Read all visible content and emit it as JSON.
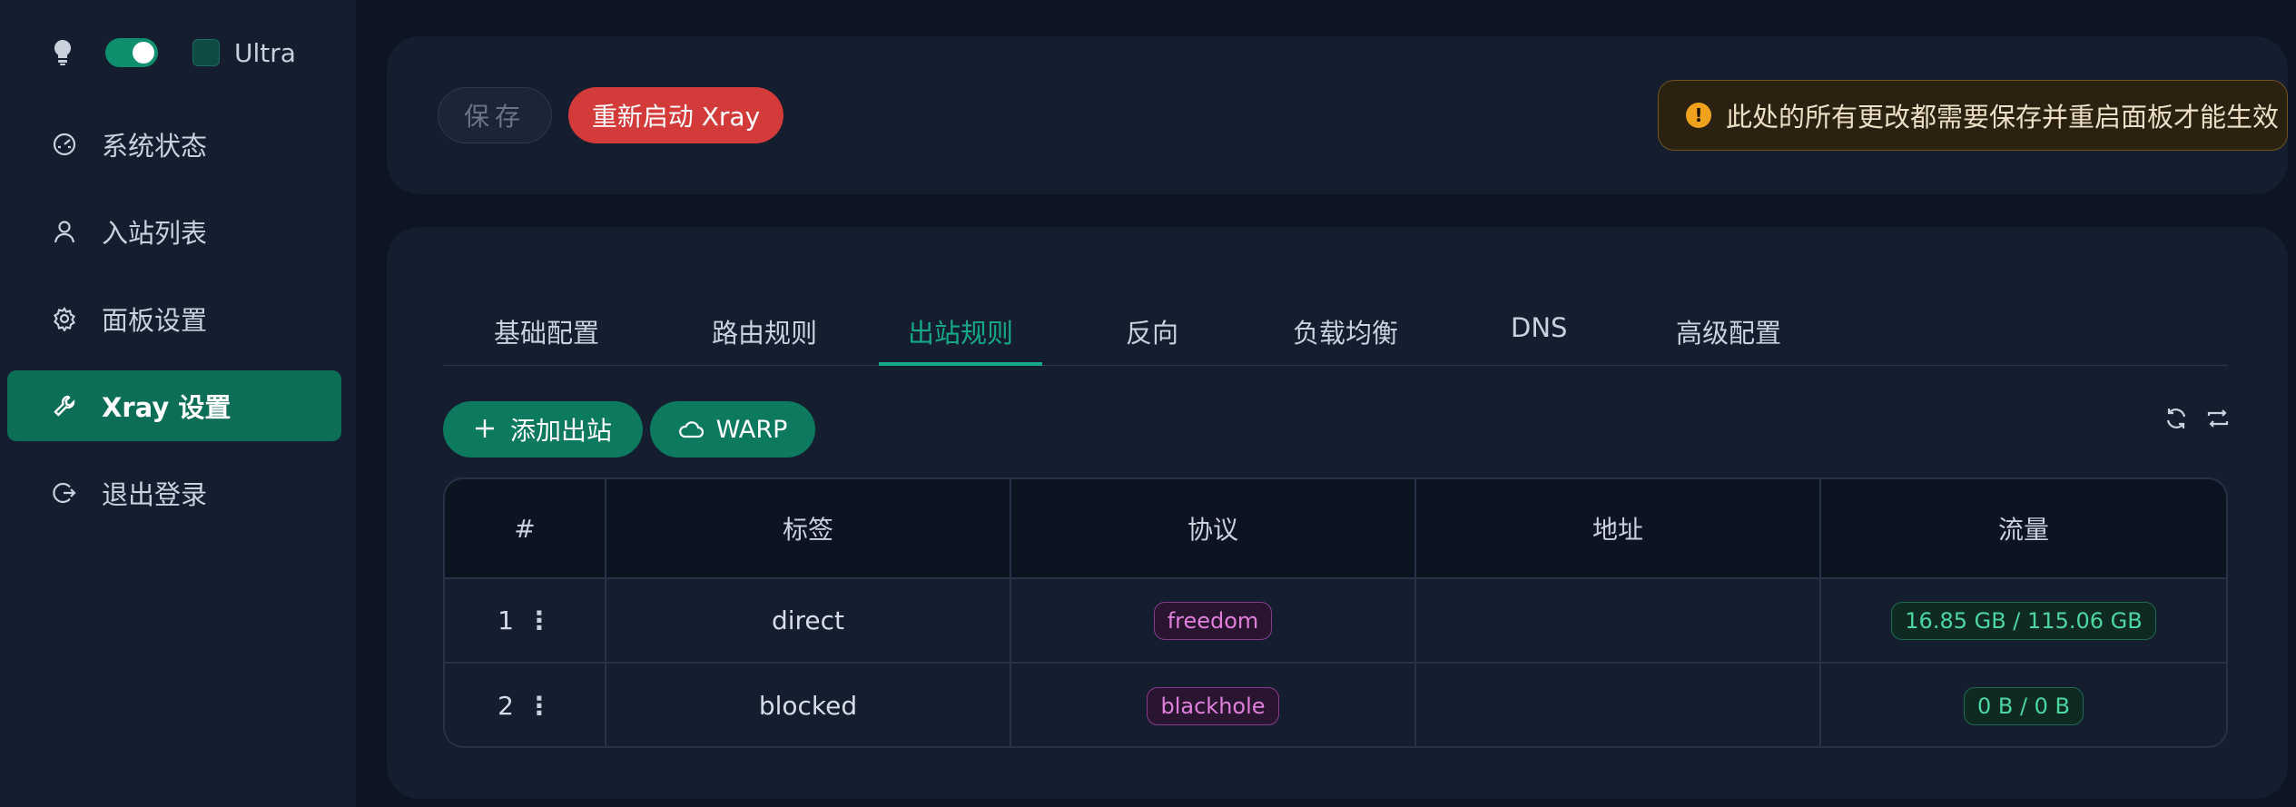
{
  "sidebar": {
    "theme": {
      "dark_mode_on": true,
      "ultra_checked": false,
      "ultra_label": "Ultra"
    },
    "items": [
      {
        "label": "系统状态",
        "icon": "dashboard-icon",
        "active": false
      },
      {
        "label": "入站列表",
        "icon": "user-icon",
        "active": false
      },
      {
        "label": "面板设置",
        "icon": "gear-icon",
        "active": false
      },
      {
        "label": "Xray 设置",
        "icon": "wrench-icon",
        "active": true
      },
      {
        "label": "退出登录",
        "icon": "logout-icon",
        "active": false
      }
    ]
  },
  "toolbar": {
    "save_label": "保存",
    "restart_label": "重新启动 Xray",
    "notice": "此处的所有更改都需要保存并重启面板才能生效",
    "notice_icon": "!"
  },
  "tabs": [
    {
      "label": "基础配置",
      "active": false
    },
    {
      "label": "路由规则",
      "active": false
    },
    {
      "label": "出站规则",
      "active": true
    },
    {
      "label": "反向",
      "active": false
    },
    {
      "label": "负载均衡",
      "active": false
    },
    {
      "label": "DNS",
      "active": false
    },
    {
      "label": "高级配置",
      "active": false
    }
  ],
  "actions": {
    "add_outbound_label": "添加出站",
    "warp_label": "WARP"
  },
  "table": {
    "columns": [
      "#",
      "标签",
      "协议",
      "地址",
      "流量"
    ],
    "rows": [
      {
        "num": "1",
        "tag": "direct",
        "protocol": "freedom",
        "address": "",
        "traffic": "16.85 GB / 115.06 GB"
      },
      {
        "num": "2",
        "tag": "blocked",
        "protocol": "blackhole",
        "address": "",
        "traffic": "0 B / 0 B"
      }
    ]
  },
  "colors": {
    "accent": "#16a886",
    "active_bg": "#0d6e58",
    "danger": "#d33a3a",
    "warning": "#f0a21c"
  }
}
